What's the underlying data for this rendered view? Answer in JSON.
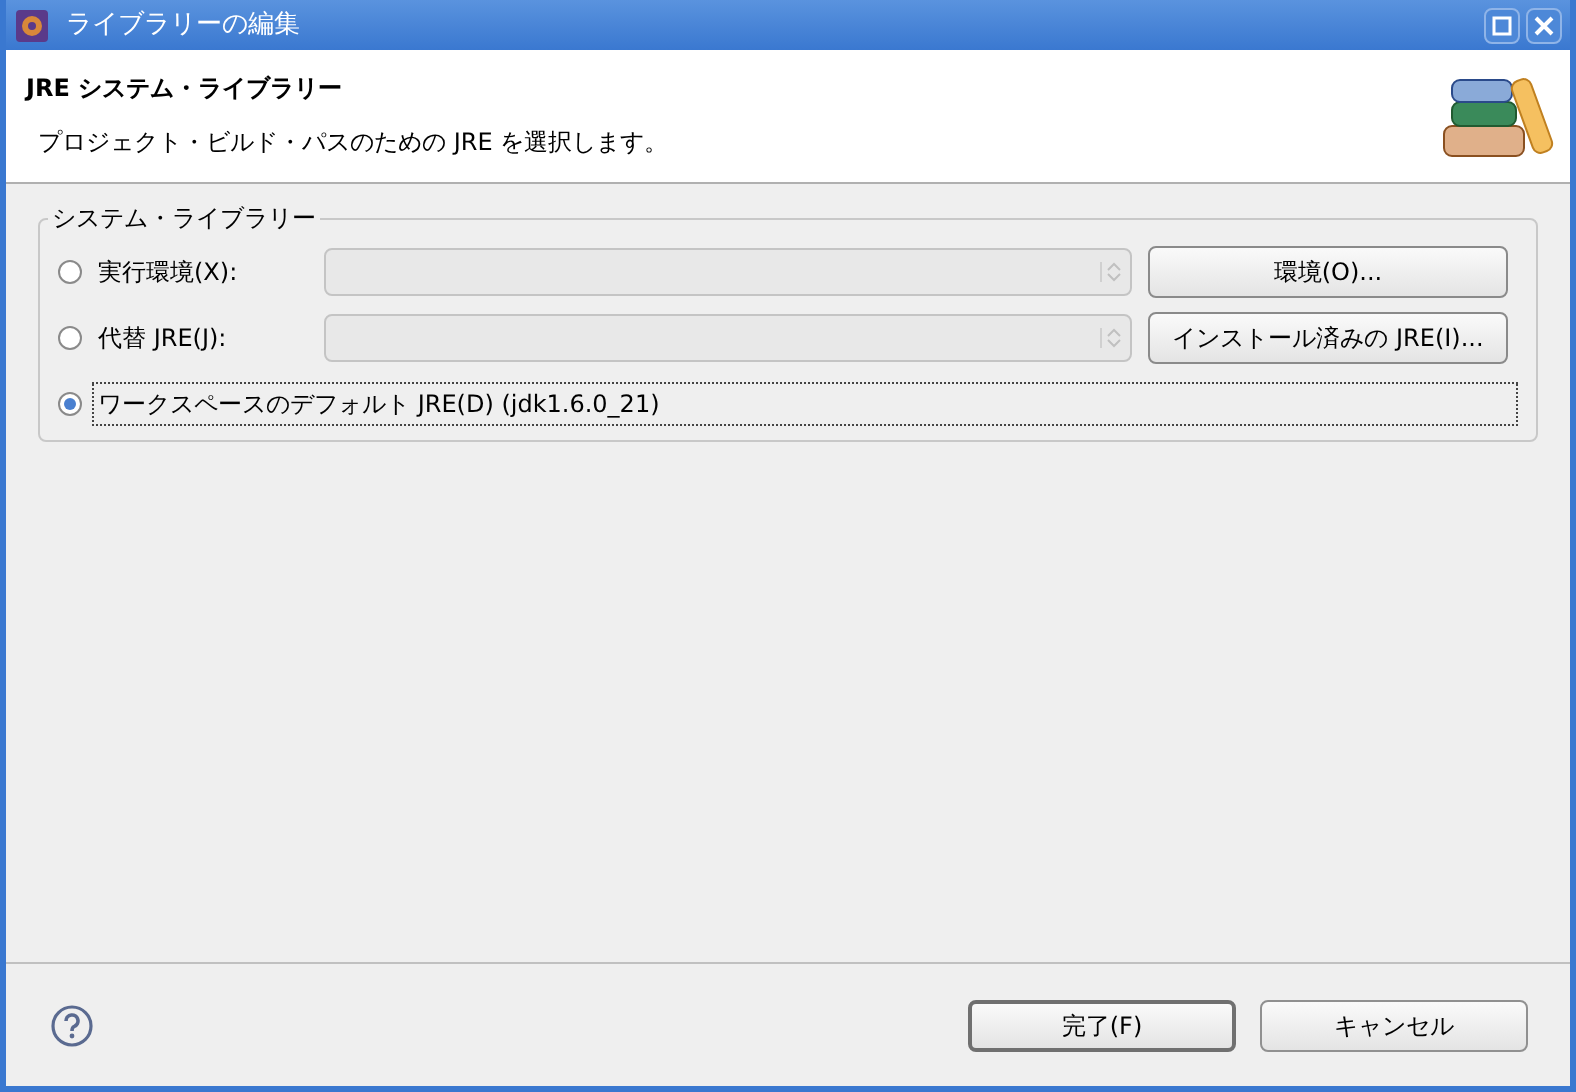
{
  "window": {
    "title": "ライブラリーの編集"
  },
  "header": {
    "title": "JRE システム・ライブラリー",
    "description": "プロジェクト・ビルド・パスのための JRE を選択します。"
  },
  "group": {
    "label": "システム・ライブラリー",
    "options": [
      {
        "kind": "combo",
        "label": "実行環境(X):",
        "selected": false,
        "focused": false,
        "button": "環境(O)..."
      },
      {
        "kind": "combo",
        "label": "代替 JRE(J):",
        "selected": false,
        "focused": false,
        "button": "インストール済みの JRE(I)..."
      },
      {
        "kind": "plain",
        "label": "ワークスペースのデフォルト JRE(D) (jdk1.6.0_21)",
        "selected": true,
        "focused": true
      }
    ]
  },
  "buttons": [
    {
      "label": "完了(F)",
      "default": true
    },
    {
      "label": "キャンセル",
      "default": false
    }
  ]
}
